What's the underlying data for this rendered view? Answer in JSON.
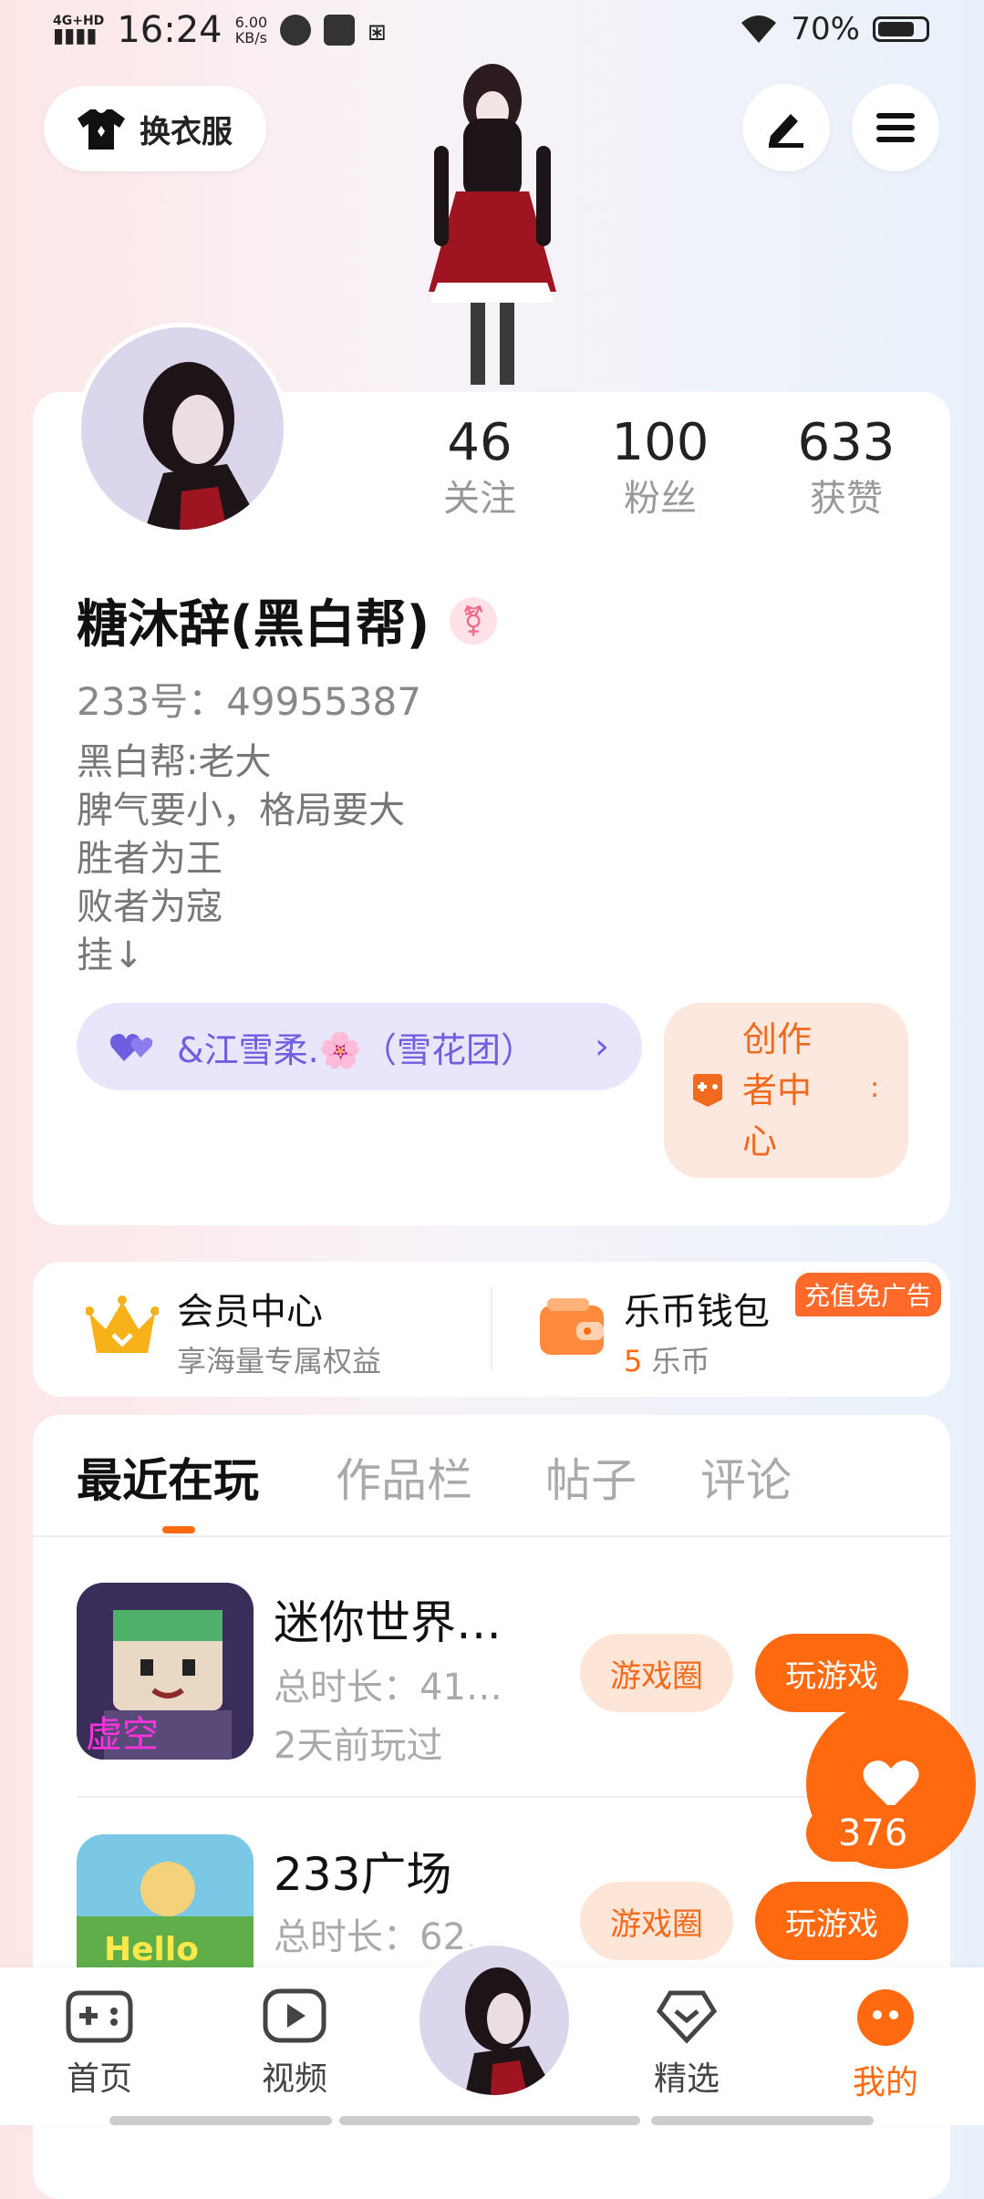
{
  "status_bar": {
    "network": "4G+HD",
    "time": "16:24",
    "speed_value": "6.00",
    "speed_unit": "KB/s",
    "battery": "70%"
  },
  "top": {
    "outfit_label": "换衣服"
  },
  "profile": {
    "stats": [
      {
        "num": "46",
        "label": "关注"
      },
      {
        "num": "100",
        "label": "粉丝"
      },
      {
        "num": "633",
        "label": "获赞"
      }
    ],
    "name": "糖沐辞(黑白帮)",
    "gender_symbol": "⚧",
    "uid": "233号：49955387",
    "bio": [
      "黑白帮:老大",
      "脾气要小，格局要大",
      "胜者为王",
      "败者为寇",
      "挂↓"
    ],
    "team": "&江雪柔.🌸（雪花团）",
    "creator_lines": [
      "创作",
      "者中",
      "心"
    ]
  },
  "member": {
    "title": "会员中心",
    "subtitle": "享海量专属权益"
  },
  "wallet": {
    "title": "乐币钱包",
    "amount": "5",
    "unit": "乐币",
    "badge": "充值免广告"
  },
  "tabs": [
    "最近在玩",
    "作品栏",
    "帖子",
    "评论"
  ],
  "games": [
    {
      "title": "迷你世界…",
      "duration": "总时长：41…",
      "last": "2天前玩过",
      "circle": "游戏圈",
      "play": "玩游戏"
    },
    {
      "title": "233广场",
      "duration": "总时长：62…",
      "circle": "游戏圈",
      "play": "玩游戏"
    }
  ],
  "like_count": "376",
  "nav": [
    "首页",
    "视频",
    "精选",
    "我的"
  ],
  "colors": {
    "accent": "#ff6a10",
    "team": "#6e5ee0"
  }
}
